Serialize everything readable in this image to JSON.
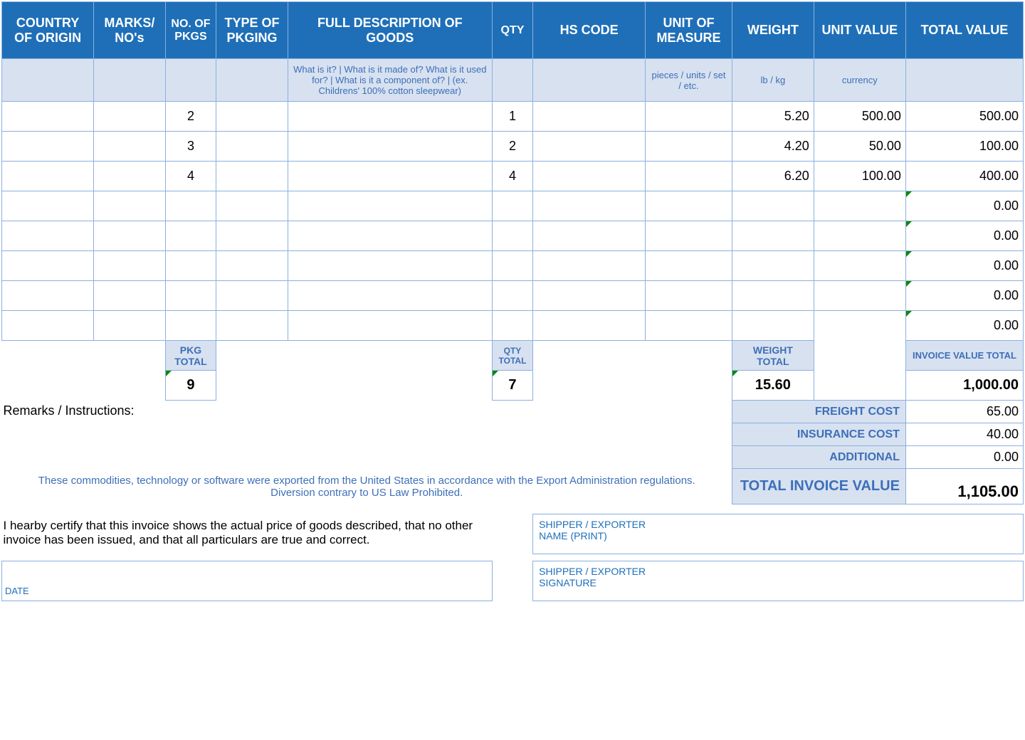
{
  "headers": {
    "country": "COUNTRY OF ORIGIN",
    "marks": "MARKS/ NO's",
    "pkgs": "NO. OF PKGS",
    "pkging": "TYPE OF PKGING",
    "desc": "FULL DESCRIPTION OF GOODS",
    "qty": "QTY",
    "hs": "HS CODE",
    "uom": "UNIT OF MEASURE",
    "weight": "WEIGHT",
    "uvalue": "UNIT VALUE",
    "tvalue": "TOTAL VALUE"
  },
  "hints": {
    "desc": "What is it? | What is it made of? What is it used for? | What is it a component of? | (ex. Childrens' 100% cotton sleepwear)",
    "uom": "pieces / units / set / etc.",
    "weight": "lb / kg",
    "uvalue": "currency"
  },
  "rows": [
    {
      "pkgs": "2",
      "qty": "1",
      "weight": "5.20",
      "uvalue": "500.00",
      "tvalue": "500.00"
    },
    {
      "pkgs": "3",
      "qty": "2",
      "weight": "4.20",
      "uvalue": "50.00",
      "tvalue": "100.00"
    },
    {
      "pkgs": "4",
      "qty": "4",
      "weight": "6.20",
      "uvalue": "100.00",
      "tvalue": "400.00"
    },
    {
      "tvalue": "0.00"
    },
    {
      "tvalue": "0.00"
    },
    {
      "tvalue": "0.00"
    },
    {
      "tvalue": "0.00"
    },
    {
      "tvalue": "0.00"
    }
  ],
  "subtotals": {
    "pkg_label": "PKG TOTAL",
    "qty_label": "QTY TOTAL",
    "weight_label": "WEIGHT TOTAL",
    "inv_label": "INVOICE VALUE TOTAL",
    "pkg": "9",
    "qty": "7",
    "weight": "15.60",
    "inv": "1,000.00"
  },
  "remarks_label": "Remarks / Instructions:",
  "costs": {
    "freight_label": "FREIGHT COST",
    "freight": "65.00",
    "insurance_label": "INSURANCE COST",
    "insurance": "40.00",
    "additional_label": "ADDITIONAL",
    "additional": "0.00",
    "total_label": "TOTAL INVOICE VALUE",
    "total": "1,105.00"
  },
  "export_note": "These commodities, technology or software were exported from the United States in accordance with the Export Administration regulations.  Diversion contrary to US Law Prohibited.",
  "certify": "I hearby certify that this invoice shows the actual price of goods described, that no other invoice has been issued, and that all particulars are true and correct.",
  "sig": {
    "name_l1": "SHIPPER / EXPORTER",
    "name_l2": "NAME (PRINT)",
    "sig_l1": "SHIPPER / EXPORTER",
    "sig_l2": "SIGNATURE",
    "date": "DATE"
  }
}
